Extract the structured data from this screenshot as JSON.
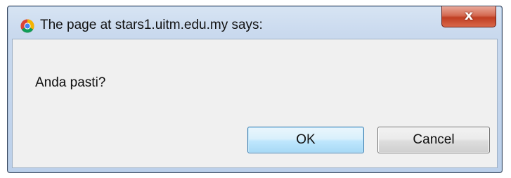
{
  "dialog": {
    "title": "The page at stars1.uitm.edu.my says:",
    "message": "Anda pasti?",
    "ok_label": "OK",
    "cancel_label": "Cancel",
    "close_glyph": "x",
    "app_icon": "chrome-icon"
  }
}
